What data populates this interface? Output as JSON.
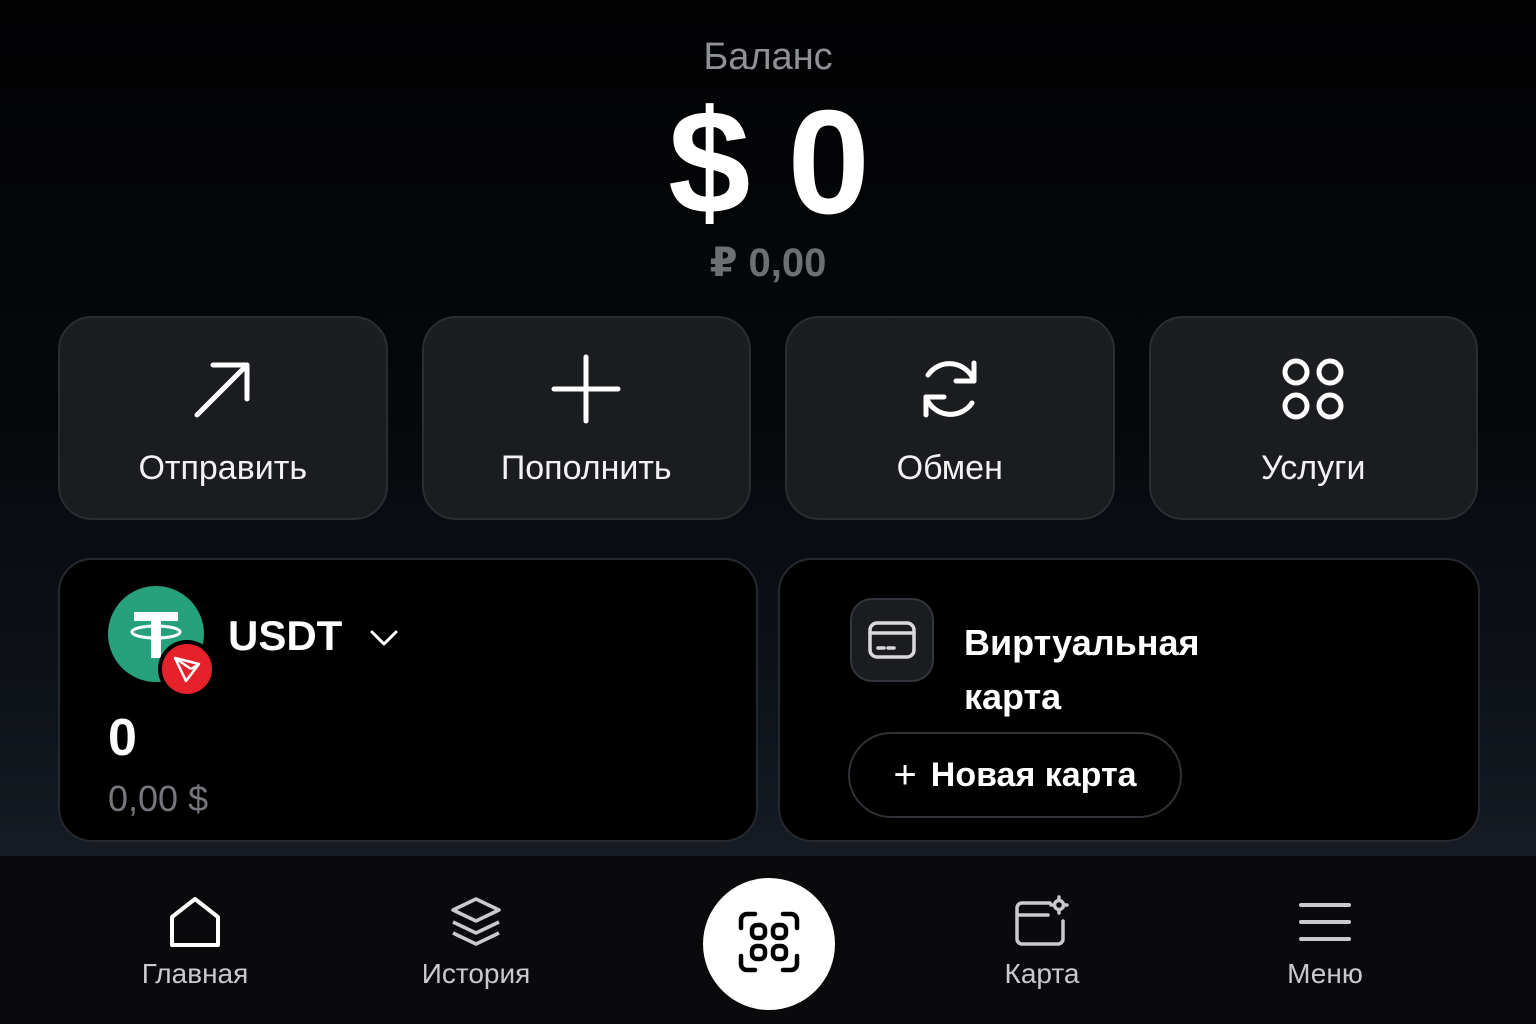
{
  "balance": {
    "label": "Баланс",
    "amount": "$ 0",
    "secondary": "₽ 0,00"
  },
  "actions": [
    {
      "label": "Отправить",
      "icon": "arrow-up-right-icon"
    },
    {
      "label": "Пополнить",
      "icon": "plus-icon"
    },
    {
      "label": "Обмен",
      "icon": "refresh-icon"
    },
    {
      "label": "Услуги",
      "icon": "grid-icon"
    }
  ],
  "wallet": {
    "token": "USDT",
    "amount": "0",
    "fiat": "0,00 $",
    "token_color": "#26a17b",
    "network_color": "#e5222a"
  },
  "virtual_card": {
    "title": "Виртуальная карта",
    "button_plus": "+",
    "button_label": "Новая карта"
  },
  "nav": [
    {
      "label": "Главная",
      "icon": "home-icon"
    },
    {
      "label": "История",
      "icon": "layers-icon"
    },
    {
      "label": "Карта",
      "icon": "card-settings-icon"
    },
    {
      "label": "Меню",
      "icon": "menu-icon"
    }
  ],
  "scan": {
    "icon": "qr-scan-icon"
  }
}
